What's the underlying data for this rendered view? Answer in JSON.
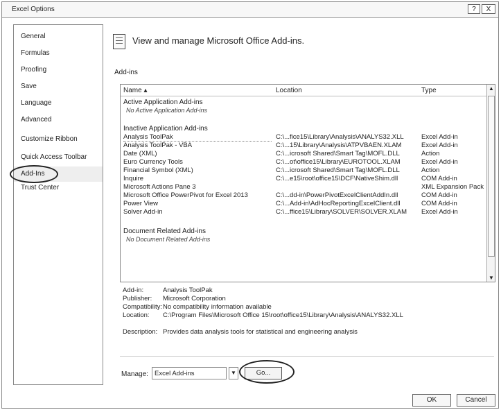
{
  "window": {
    "title": "Excel Options",
    "help_label": "?",
    "close_label": "X"
  },
  "sidebar": {
    "items": [
      {
        "label": "General"
      },
      {
        "label": "Formulas"
      },
      {
        "label": "Proofing"
      },
      {
        "label": "Save"
      },
      {
        "label": "Language"
      },
      {
        "label": "Advanced"
      },
      {
        "label": "Customize Ribbon"
      },
      {
        "label": "Quick Access Toolbar"
      },
      {
        "label": "Add-Ins",
        "active": true
      },
      {
        "label": "Trust Center"
      }
    ]
  },
  "main": {
    "header_title": "View and manage Microsoft Office Add-ins.",
    "section_label": "Add-ins",
    "table": {
      "columns": {
        "name": "Name ▴",
        "location": "Location",
        "type": "Type"
      },
      "groups": {
        "active_title": "Active Application Add-ins",
        "active_empty": "No Active Application Add-ins",
        "inactive_title": "Inactive Application Add-ins",
        "document_title": "Document Related Add-ins",
        "document_empty": "No Document Related Add-ins"
      },
      "rows": [
        {
          "name": "Analysis ToolPak",
          "location": "C:\\...fice15\\Library\\Analysis\\ANALYS32.XLL",
          "type": "Excel Add-in"
        },
        {
          "name": "Analysis ToolPak - VBA",
          "location": "C:\\...15\\Library\\Analysis\\ATPVBAEN.XLAM",
          "type": "Excel Add-in"
        },
        {
          "name": "Date (XML)",
          "location": "C:\\...icrosoft Shared\\Smart Tag\\MOFL.DLL",
          "type": "Action"
        },
        {
          "name": "Euro Currency Tools",
          "location": "C:\\...ot\\office15\\Library\\EUROTOOL.XLAM",
          "type": "Excel Add-in"
        },
        {
          "name": "Financial Symbol (XML)",
          "location": "C:\\...icrosoft Shared\\Smart Tag\\MOFL.DLL",
          "type": "Action"
        },
        {
          "name": "Inquire",
          "location": "C:\\...e15\\root\\office15\\DCF\\NativeShim.dll",
          "type": "COM Add-in"
        },
        {
          "name": "Microsoft Actions Pane 3",
          "location": "",
          "type": "XML Expansion Pack"
        },
        {
          "name": "Microsoft Office PowerPivot for Excel 2013",
          "location": "C:\\...dd-in\\PowerPivotExcelClientAddIn.dll",
          "type": "COM Add-in"
        },
        {
          "name": "Power View",
          "location": "C:\\...Add-in\\AdHocReportingExcelClient.dll",
          "type": "COM Add-in"
        },
        {
          "name": "Solver Add-in",
          "location": "C:\\...ffice15\\Library\\SOLVER\\SOLVER.XLAM",
          "type": "Excel Add-in"
        }
      ]
    },
    "details": {
      "addin_label": "Add-in:",
      "addin_value": "Analysis ToolPak",
      "publisher_label": "Publisher:",
      "publisher_value": "Microsoft Corporation",
      "compat_label": "Compatibility:",
      "compat_value": "No compatibility information available",
      "location_label": "Location:",
      "location_value": "C:\\Program Files\\Microsoft Office 15\\root\\office15\\Library\\Analysis\\ANALYS32.XLL",
      "description_label": "Description:",
      "description_value": "Provides data analysis tools for statistical and engineering analysis"
    },
    "manage": {
      "label": "Manage:",
      "selected": "Excel Add-ins",
      "go_label": "Go..."
    }
  },
  "footer": {
    "ok_label": "OK",
    "cancel_label": "Cancel"
  }
}
